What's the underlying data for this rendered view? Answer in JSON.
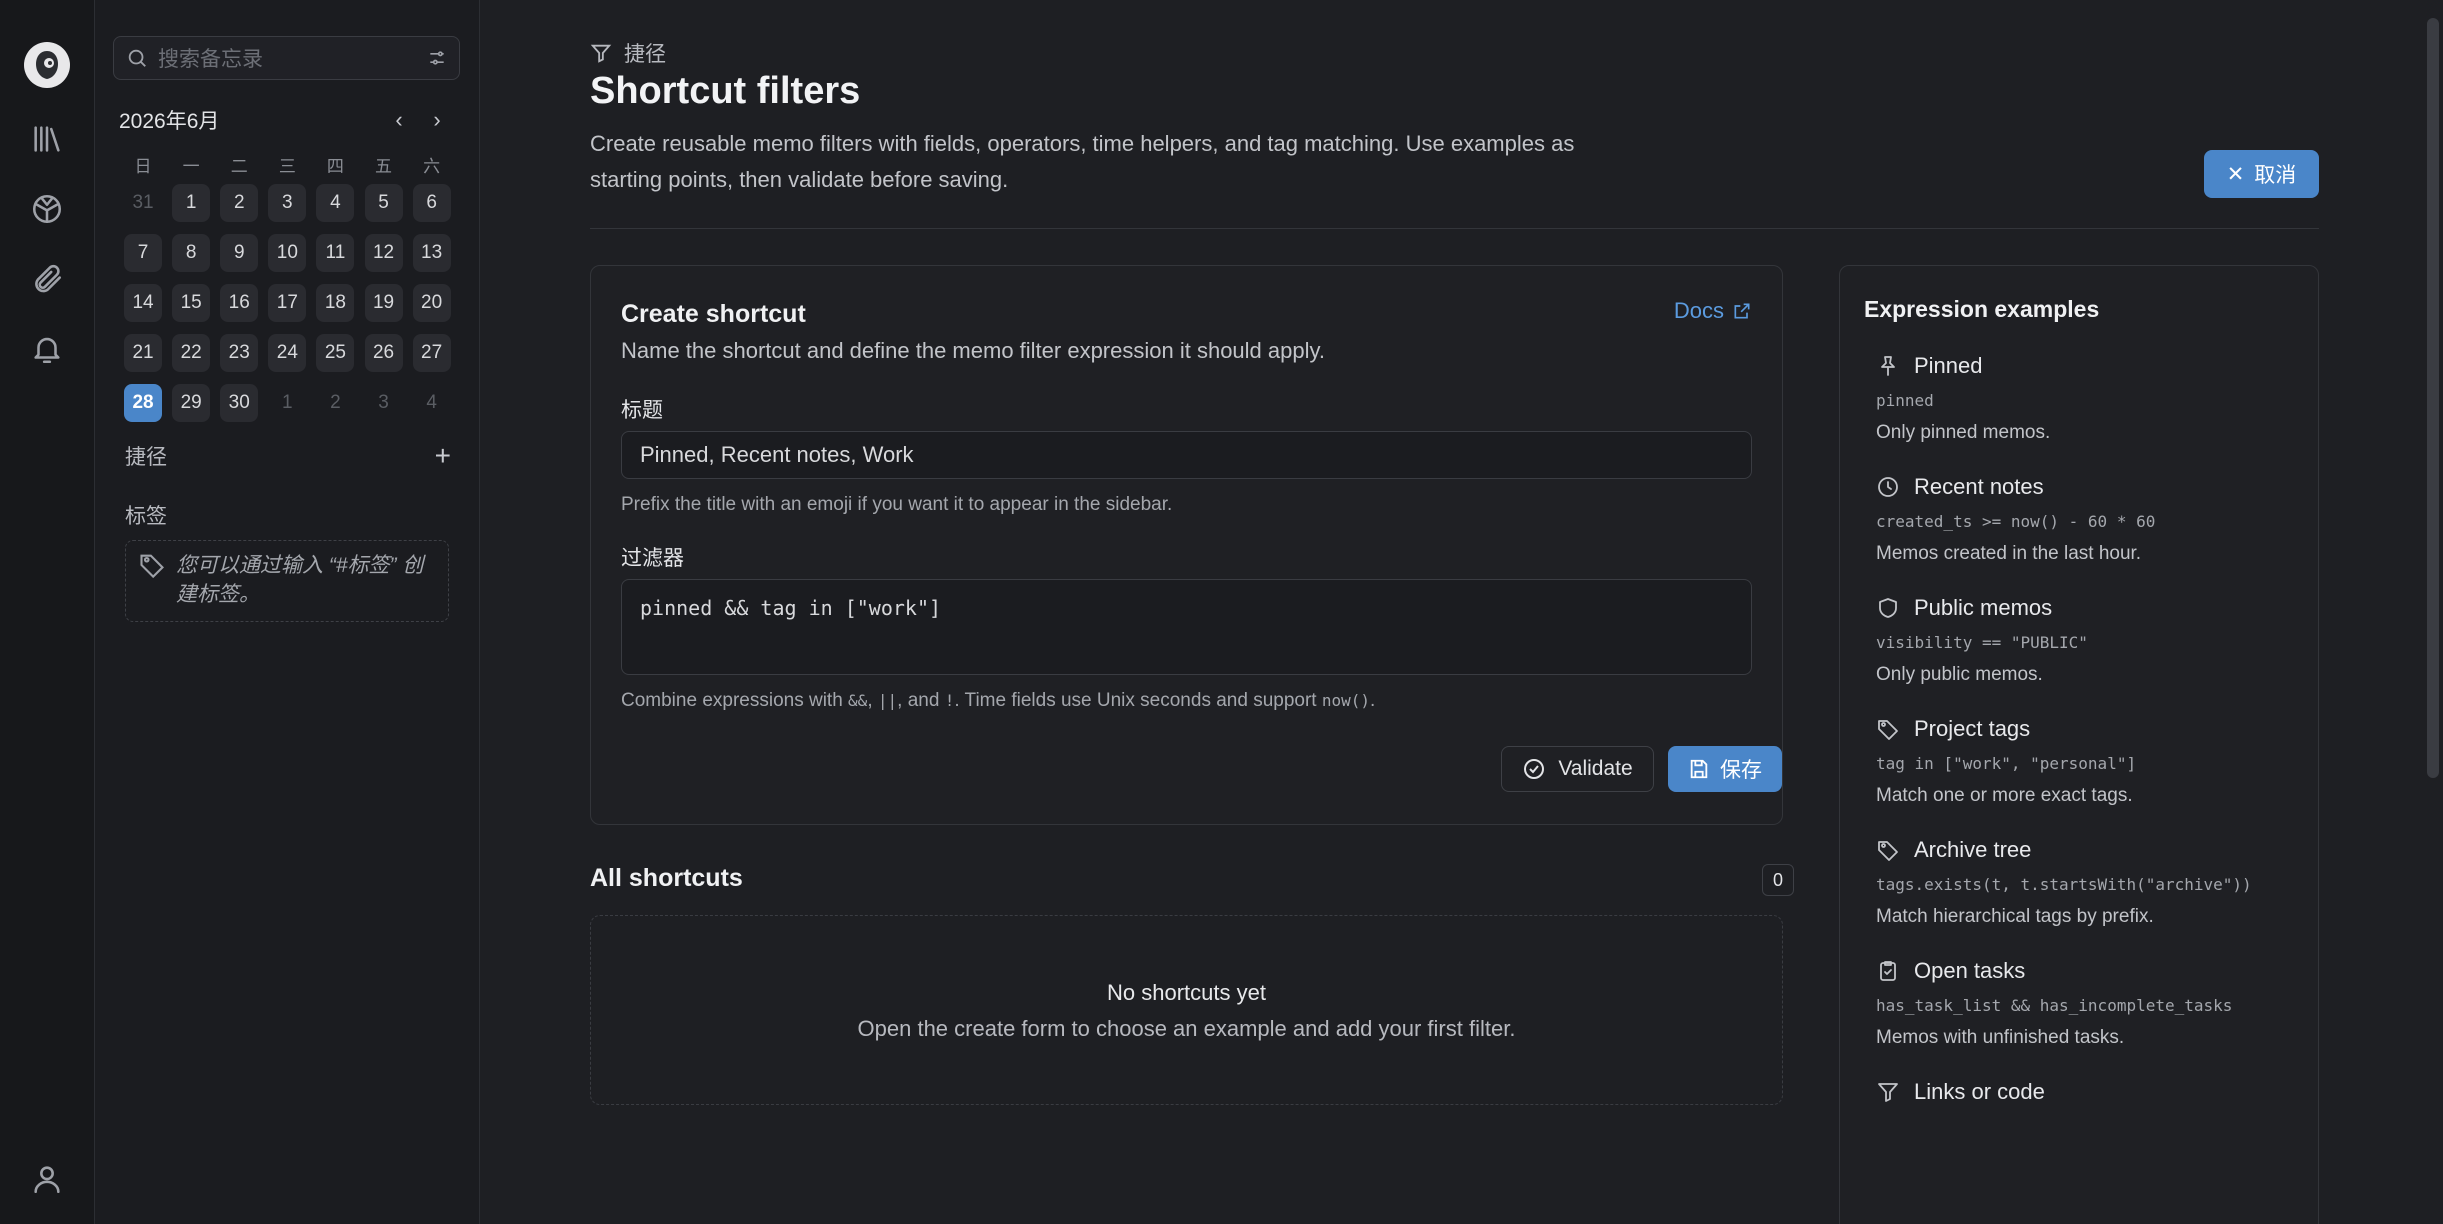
{
  "sidebar": {
    "search_placeholder": "搜索备忘录",
    "calendar": {
      "title": "2026年6月",
      "weekdays": [
        "日",
        "一",
        "二",
        "三",
        "四",
        "五",
        "六"
      ],
      "weeks": [
        [
          "31",
          "1",
          "2",
          "3",
          "4",
          "5",
          "6"
        ],
        [
          "7",
          "8",
          "9",
          "10",
          "11",
          "12",
          "13"
        ],
        [
          "14",
          "15",
          "16",
          "17",
          "18",
          "19",
          "20"
        ],
        [
          "21",
          "22",
          "23",
          "24",
          "25",
          "26",
          "27"
        ],
        [
          "28",
          "29",
          "30",
          "1",
          "2",
          "3",
          "4"
        ]
      ],
      "today": "28"
    },
    "shortcuts_label": "捷径",
    "tags_label": "标签",
    "tags_empty_hint": "您可以通过输入 “#标签” 创建标签。"
  },
  "main": {
    "breadcrumb": "捷径",
    "title": "Shortcut filters",
    "lead": "Create reusable memo filters with fields, operators, time helpers, and tag matching. Use examples as starting points, then validate before saving.",
    "cancel_label": "取消",
    "create": {
      "title": "Create shortcut",
      "docs_label": "Docs",
      "subtitle": "Name the shortcut and define the memo filter expression it should apply.",
      "title_label": "标题",
      "title_placeholder": "Pinned, Recent notes, Work",
      "title_hint": "Prefix the title with an emoji if you want it to appear in the sidebar.",
      "filter_label": "过滤器",
      "filter_placeholder": "pinned && tag in [\"work\"]",
      "filter_hint_parts": [
        "Combine expressions with ",
        "&&",
        ", ",
        "||",
        ", and ",
        "!",
        ". Time fields use Unix seconds and support ",
        "now()",
        "."
      ],
      "validate_label": "Validate",
      "save_label": "保存"
    },
    "all": {
      "title": "All shortcuts",
      "count": "0",
      "empty_title": "No shortcuts yet",
      "empty_desc": "Open the create form to choose an example and add your first filter."
    },
    "examples": {
      "title": "Expression examples",
      "items": [
        {
          "icon": "pin-icon",
          "name": "Pinned",
          "code": "pinned",
          "desc": "Only pinned memos."
        },
        {
          "icon": "clock-icon",
          "name": "Recent notes",
          "code": "created_ts >= now() - 60 * 60",
          "desc": "Memos created in the last hour."
        },
        {
          "icon": "shield-icon",
          "name": "Public memos",
          "code": "visibility == \"PUBLIC\"",
          "desc": "Only public memos."
        },
        {
          "icon": "tag-icon",
          "name": "Project tags",
          "code": "tag in [\"work\", \"personal\"]",
          "desc": "Match one or more exact tags."
        },
        {
          "icon": "tag-icon",
          "name": "Archive tree",
          "code": "tags.exists(t, t.startsWith(\"archive\"))",
          "desc": "Match hierarchical tags by prefix."
        },
        {
          "icon": "clipboard-check-icon",
          "name": "Open tasks",
          "code": "has_task_list && has_incomplete_tasks",
          "desc": "Memos with unfinished tasks."
        },
        {
          "icon": "filter-icon",
          "name": "Links or code",
          "code": "",
          "desc": ""
        }
      ]
    }
  }
}
